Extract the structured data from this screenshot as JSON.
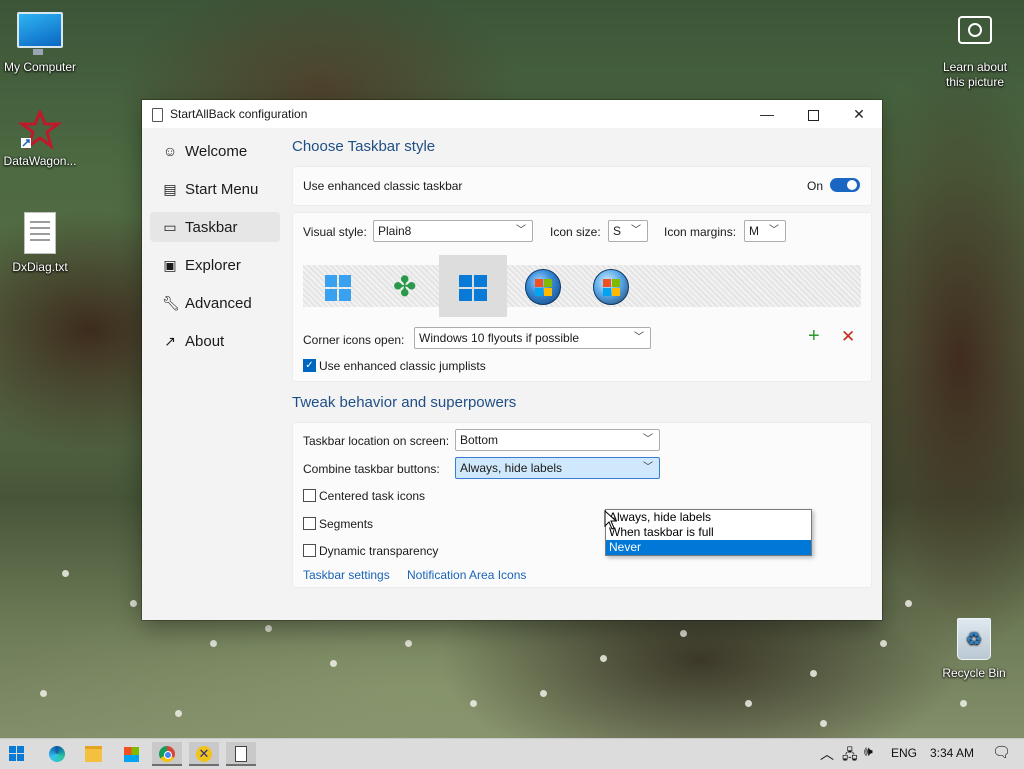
{
  "desktop": {
    "icons": [
      {
        "label": "My Computer",
        "icon": "computer-icon"
      },
      {
        "label": "DataWagon...",
        "icon": "datawagon-icon"
      },
      {
        "label": "DxDiag.txt",
        "icon": "text-file-icon"
      },
      {
        "label": "Learn about this picture",
        "icon": "camera-icon"
      },
      {
        "label": "Recycle Bin",
        "icon": "recycle-bin-icon"
      }
    ]
  },
  "window": {
    "title": "StartAllBack configuration",
    "controls": {
      "minimize": "—",
      "maximize": "□",
      "close": "✕"
    }
  },
  "sidebar": {
    "items": [
      {
        "label": "Welcome",
        "icon": "smile-icon",
        "active": false
      },
      {
        "label": "Start Menu",
        "icon": "start-menu-icon",
        "active": false
      },
      {
        "label": "Taskbar",
        "icon": "taskbar-icon",
        "active": true
      },
      {
        "label": "Explorer",
        "icon": "explorer-icon",
        "active": false
      },
      {
        "label": "Advanced",
        "icon": "wrench-icon",
        "active": false
      },
      {
        "label": "About",
        "icon": "about-icon",
        "active": false
      }
    ]
  },
  "style_section": {
    "title": "Choose Taskbar style",
    "enhanced_label": "Use enhanced classic taskbar",
    "toggle_state": "On",
    "visual_style_label": "Visual style:",
    "visual_style_value": "Plain8",
    "icon_size_label": "Icon size:",
    "icon_size_value": "S",
    "icon_margins_label": "Icon margins:",
    "icon_margins_value": "M",
    "styles": [
      "windows-11-style",
      "clover-style",
      "windows-10-style",
      "windows-7-orb-style",
      "windows-vista-orb-style"
    ],
    "selected_style": 2,
    "corner_label": "Corner icons open:",
    "corner_value": "Windows 10 flyouts if possible",
    "jumplists_label": "Use enhanced classic jumplists",
    "jumplists_checked": true
  },
  "tweak_section": {
    "title": "Tweak behavior and superpowers",
    "location_label": "Taskbar location on screen:",
    "location_value": "Bottom",
    "combine_label": "Combine taskbar buttons:",
    "combine_value": "Always, hide labels",
    "combine_options": [
      "Always, hide labels",
      "When taskbar is full",
      "Never"
    ],
    "combine_highlighted": 2,
    "centered_label": "Centered task icons",
    "segments_label": "Segments",
    "transparency_label": "Dynamic transparency",
    "link_taskbar_settings": "Taskbar settings",
    "link_notification_icons": "Notification Area Icons"
  },
  "taskbar": {
    "apps": [
      "start-button",
      "edge-icon",
      "file-explorer-icon",
      "store-icon",
      "chrome-icon",
      "app-icon",
      "startallback-icon"
    ],
    "tray": {
      "language": "ENG",
      "time": "3:34 AM"
    }
  },
  "colors": {
    "accent": "#0067c0",
    "section_title": "#1f4f86",
    "link": "#1a64b8"
  }
}
